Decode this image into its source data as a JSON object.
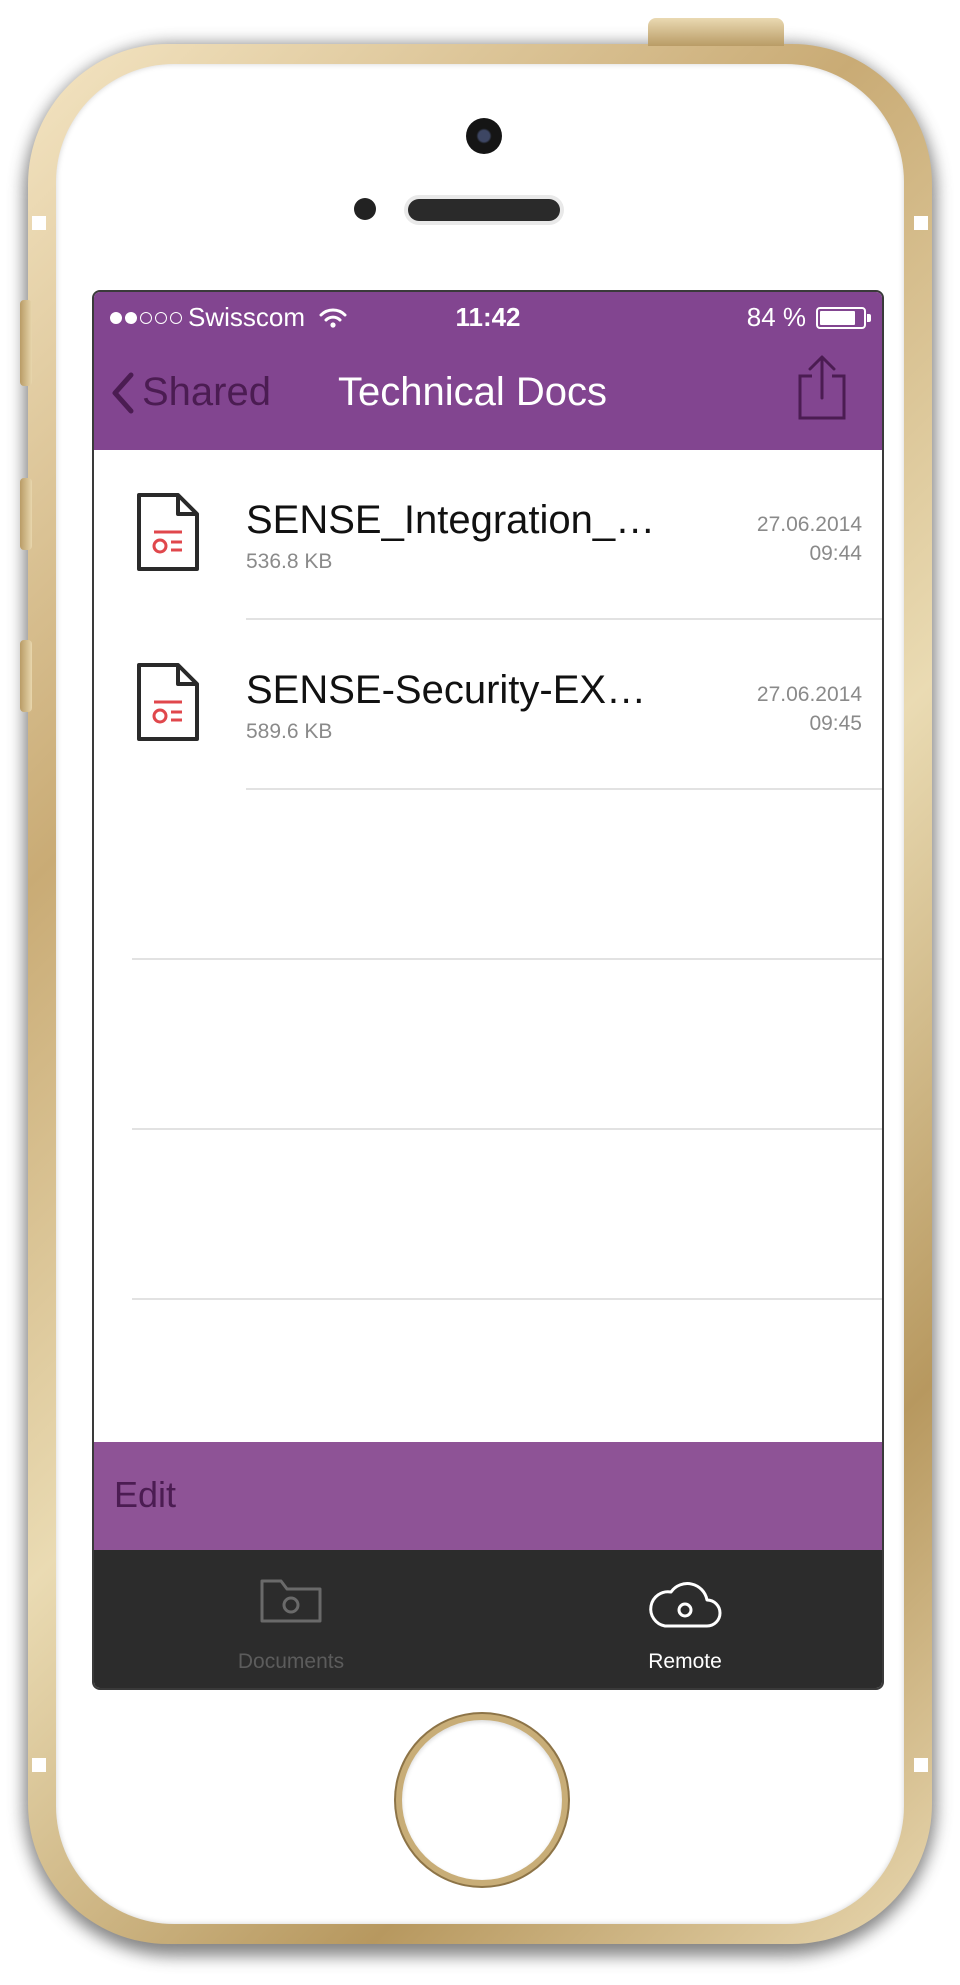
{
  "status_bar": {
    "carrier": "Swisscom",
    "signal_bars": 2,
    "signal_total": 5,
    "time": "11:42",
    "battery_label": "84 %",
    "battery_level": 0.84
  },
  "nav": {
    "back_label": "Shared",
    "title": "Technical Docs"
  },
  "files": [
    {
      "name": "SENSE_Integration_…",
      "size": "536.8 KB",
      "date": "27.06.2014",
      "time": "09:44"
    },
    {
      "name": "SENSE-Security-EX…",
      "size": "589.6 KB",
      "date": "27.06.2014",
      "time": "09:45"
    }
  ],
  "toolbar": {
    "edit_label": "Edit"
  },
  "tabs": [
    {
      "label": "Documents",
      "icon": "folder-icon",
      "active": false
    },
    {
      "label": "Remote",
      "icon": "cloud-icon",
      "active": true
    }
  ],
  "colors": {
    "accent": "#824590",
    "edit_bar": "#8e5396",
    "tab_bar": "#2c2c2c",
    "pdf_red": "#e0474c"
  }
}
